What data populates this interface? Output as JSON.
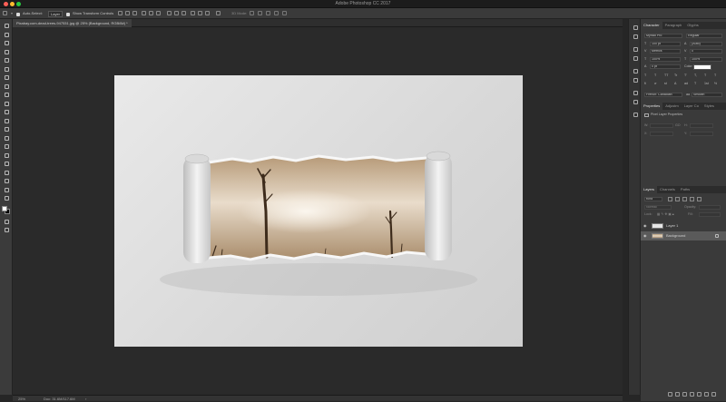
{
  "app": {
    "title": "Adobe Photoshop CC 2017",
    "window_controls": {
      "close_color": "#ff5f57",
      "minimize_color": "#febc2e",
      "maximize_color": "#28c840"
    }
  },
  "options_bar": {
    "auto_select_label": "Auto-Select:",
    "auto_select_value": "Layer",
    "show_transform_label": "Show Transform Controls",
    "mode_3d_label": "3D Mode:"
  },
  "document": {
    "tab_title": "Pixabay.com-dead-trees-947531.jpg @ 25% (Background, RGB/8#) *",
    "zoom": "25%",
    "doc_info": "Doc: 31.6M/117.6M"
  },
  "character_panel": {
    "tabs": [
      "Character",
      "Paragraph",
      "Glyphs"
    ],
    "font_family": "Myriad Pro",
    "font_style": "Regular",
    "font_size": "100 pt",
    "leading": "(Auto)",
    "kerning": "Metrics",
    "tracking": "0",
    "vertical_scale": "100%",
    "horizontal_scale": "100%",
    "baseline_shift": "0 pt",
    "color_label": "Color:",
    "language": "French: Canadian",
    "aa_label": "aa",
    "antialias": "Smooth",
    "style_buttons": [
      "T",
      "T",
      "TT",
      "Tr",
      "T'",
      "T,",
      "T",
      "T"
    ],
    "opentype_buttons": [
      "fi",
      "ơ",
      "st",
      "A",
      "ad",
      "T",
      "1st",
      "½"
    ]
  },
  "properties_panel": {
    "tabs": [
      "Properties",
      "Adjustm",
      "Layer Co",
      "Styles"
    ],
    "heading": "Pixel Layer Properties",
    "w_label": "W:",
    "h_label": "H:",
    "x_label": "X:",
    "y_label": "Y:",
    "w_value": "",
    "x_value": "",
    "y_value": "",
    "link_label": "GO"
  },
  "layers_panel": {
    "tabs": [
      "Layers",
      "Channels",
      "Paths"
    ],
    "kind_filter": "Kind",
    "blend_mode": "Normal",
    "opacity_label": "Opacity:",
    "opacity_value": "",
    "lock_label": "Lock:",
    "fill_label": "Fill:",
    "fill_value": "",
    "layers": [
      {
        "name": "Layer 1",
        "visible": true,
        "selected": false
      },
      {
        "name": "Background",
        "visible": true,
        "selected": true,
        "locked": true
      }
    ],
    "footer_icons": [
      "link-icon",
      "fx-icon",
      "mask-icon",
      "adjustment-icon",
      "group-icon",
      "new-layer-icon",
      "trash-icon"
    ]
  },
  "toolbar": {
    "tools": [
      "move-tool",
      "marquee-tool",
      "lasso-tool",
      "quick-select-tool",
      "crop-tool",
      "eyedropper-tool",
      "healing-brush-tool",
      "brush-tool",
      "clone-stamp-tool",
      "history-brush-tool",
      "eraser-tool",
      "gradient-tool",
      "blur-tool",
      "dodge-tool",
      "pen-tool",
      "type-tool",
      "path-select-tool",
      "rectangle-tool",
      "hand-tool",
      "zoom-tool",
      "more-tools"
    ],
    "foreground_color": "#ffffff",
    "background_color": "#000000"
  },
  "colors": {
    "accent_selected_row": "#5a5a5a",
    "workspace": "#2a2a2a",
    "panel": "#3a3a3a"
  }
}
